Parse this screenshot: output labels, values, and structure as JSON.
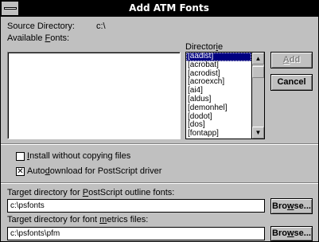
{
  "window": {
    "title": "Add ATM Fonts"
  },
  "source": {
    "label": "Source Directory:",
    "value": "c:\\"
  },
  "available_fonts": {
    "label_pre": "Available ",
    "label_u": "F",
    "label_post": "onts:"
  },
  "directories": {
    "label_pre": "Director",
    "label_u": "i",
    "label_post": "e",
    "items": [
      "[aadist]",
      "[acrobat]",
      "[acrodist]",
      "[acroexch]",
      "[ai4]",
      "[aldus]",
      "[demonhel]",
      "[dodot]",
      "[dos]",
      "[fontapp]"
    ],
    "selected_index": 0
  },
  "scrollbar": {
    "up_glyph": "▲",
    "down_glyph": "▼"
  },
  "buttons": {
    "add_pre": "",
    "add_u": "A",
    "add_post": "dd",
    "cancel": "Cancel",
    "browse1_pre": "Bro",
    "browse1_u": "w",
    "browse1_post": "se...",
    "browse2_pre": "Bro",
    "browse2_u": "w",
    "browse2_post": "se..."
  },
  "options": {
    "install_without_copying": {
      "pre": "",
      "u": "I",
      "post": "nstall without copying files",
      "checked": false
    },
    "autodownload": {
      "pre": "Auto",
      "u": "d",
      "post": "ownload for PostScript driver",
      "checked": true,
      "mark": "✕"
    }
  },
  "target_outline": {
    "label_pre": "Target directory for ",
    "label_u": "P",
    "label_post": "ostScript outline fonts:",
    "value": "c:\\psfonts"
  },
  "target_metrics": {
    "label_pre": "Target directory for font ",
    "label_u": "m",
    "label_post": "etrics files:",
    "value": "c:\\psfonts\\pfm"
  }
}
